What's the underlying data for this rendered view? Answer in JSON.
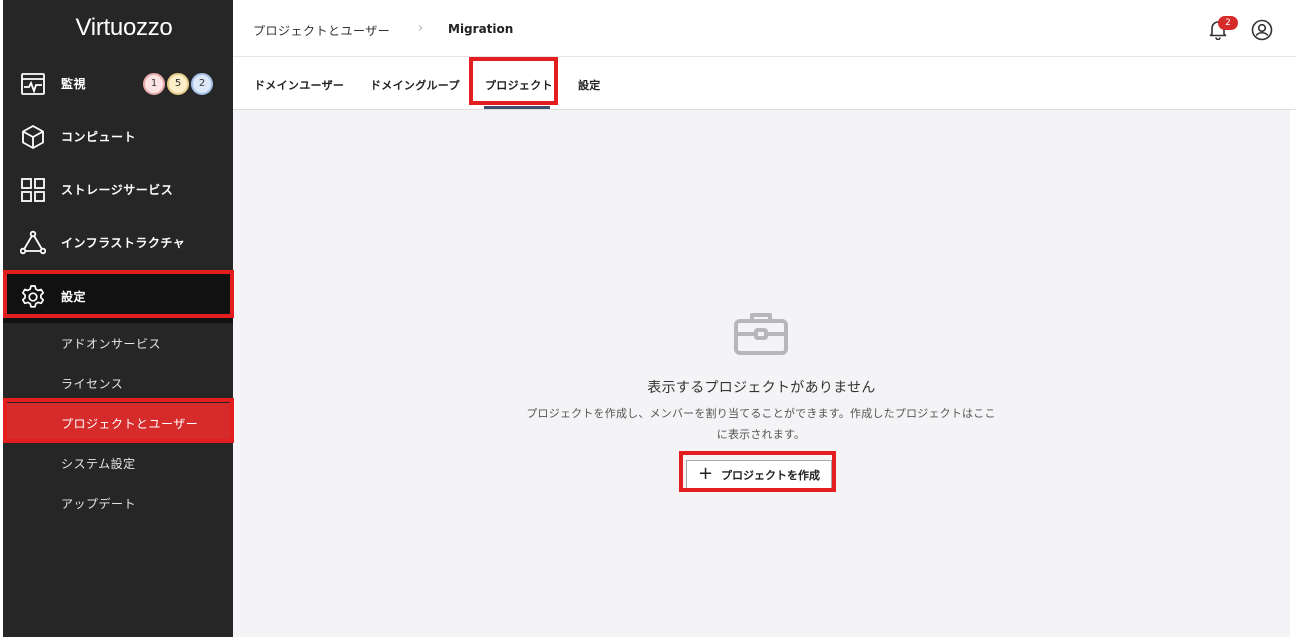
{
  "app": {
    "logo": "Virtuozzo"
  },
  "sidebar": {
    "items": [
      {
        "label": "監視",
        "icon": "monitor-icon"
      },
      {
        "label": "コンピュート",
        "icon": "cube-icon"
      },
      {
        "label": "ストレージサービス",
        "icon": "grid-icon"
      },
      {
        "label": "インフラストラクチャ",
        "icon": "triangle-nodes-icon"
      },
      {
        "label": "設定",
        "icon": "gear-icon"
      }
    ],
    "badges": [
      "1",
      "5",
      "2"
    ],
    "sub_items": [
      {
        "label": "アドオンサービス"
      },
      {
        "label": "ライセンス"
      },
      {
        "label": "プロジェクトとユーザー"
      },
      {
        "label": "システム設定"
      },
      {
        "label": "アップデート"
      }
    ]
  },
  "header": {
    "breadcrumb": [
      "プロジェクトとユーザー",
      "Migration"
    ],
    "breadcrumb_separator": "›",
    "notification_count": "2"
  },
  "tabs": [
    {
      "label": "ドメインユーザー"
    },
    {
      "label": "ドメイングループ"
    },
    {
      "label": "プロジェクト"
    },
    {
      "label": "設定"
    }
  ],
  "main": {
    "empty_title": "表示するプロジェクトがありません",
    "empty_desc": "プロジェクトを作成し、メンバーを割り当てることができます。作成したプロジェクトはここに表示されます。",
    "create_button": "プロジェクトを作成",
    "create_button_icon": "+"
  },
  "colors": {
    "sidebar_bg": "#262626",
    "highlight": "#e41e1e",
    "selected_bg": "#d52b2b",
    "tab_underline": "#3d4f6d",
    "main_bg": "#f4f4f6"
  }
}
